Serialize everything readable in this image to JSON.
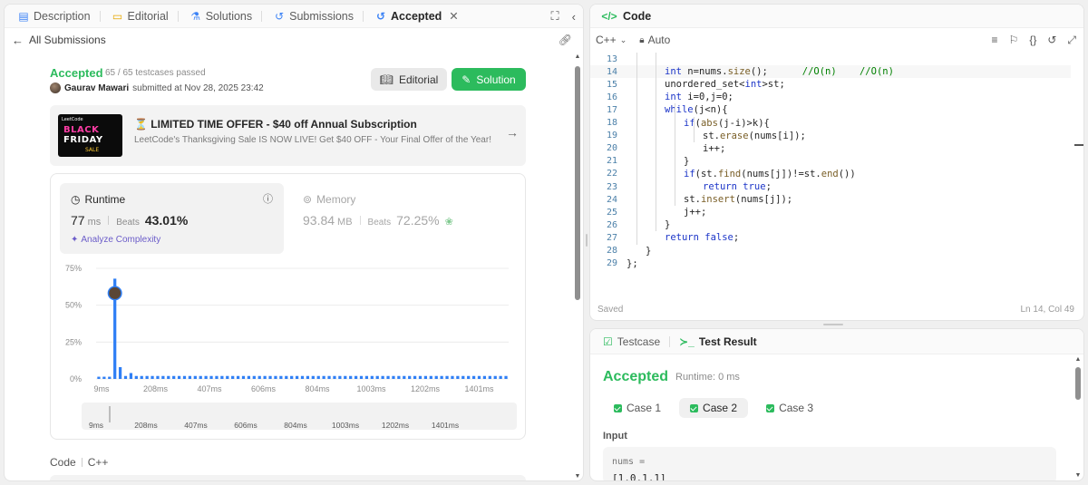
{
  "left_tabs": [
    {
      "label": "Description",
      "icon": "description-icon"
    },
    {
      "label": "Editorial",
      "icon": "book-icon"
    },
    {
      "label": "Solutions",
      "icon": "flask-icon"
    },
    {
      "label": "Submissions",
      "icon": "history-icon"
    },
    {
      "label": "Accepted",
      "icon": "history-icon"
    }
  ],
  "back_link": "All Submissions",
  "submission": {
    "status": "Accepted",
    "testcases": "65 / 65 testcases passed",
    "author": "Gaurav Mawari",
    "submitted_text": "submitted at Nov 28, 2025 23:42",
    "editorial_btn": "Editorial",
    "solution_btn": "Solution"
  },
  "promo": {
    "img_top": "LeetCode",
    "img_line1": "BLACK",
    "img_line2": "FRIDAY",
    "img_line3": "SALE",
    "title": "⏳ LIMITED TIME OFFER - $40 off Annual Subscription",
    "subtitle": "LeetCode's Thanksgiving Sale IS NOW LIVE! Get $40 OFF - Your Final Offer of the Year!"
  },
  "runtime": {
    "label": "Runtime",
    "value": "77",
    "unit": "ms",
    "beats_label": "Beats",
    "beats": "43.01%",
    "analyze": "Analyze Complexity"
  },
  "memory": {
    "label": "Memory",
    "value": "93.84",
    "unit": "MB",
    "beats_label": "Beats",
    "beats": "72.25%"
  },
  "chart_data": {
    "type": "bar",
    "y_ticks": [
      "75%",
      "50%",
      "25%",
      "0%"
    ],
    "ylim": [
      0,
      75
    ],
    "x_tick_labels": [
      "9ms",
      "208ms",
      "407ms",
      "606ms",
      "804ms",
      "1003ms",
      "1202ms",
      "1401ms"
    ],
    "values": [
      1.5,
      1.5,
      1.5,
      68,
      8,
      2,
      4,
      2,
      2,
      2,
      2,
      2,
      2,
      2,
      2,
      2,
      2,
      2,
      2,
      2,
      2,
      2,
      2,
      2,
      2,
      2,
      2,
      2,
      2,
      2,
      2,
      2,
      2,
      2,
      2,
      2,
      2,
      2,
      2,
      2,
      2,
      2,
      2,
      2,
      2,
      2,
      2,
      2,
      2,
      2,
      2,
      2,
      2,
      2,
      2,
      2,
      2,
      2,
      2,
      2,
      2,
      2,
      2,
      2,
      2,
      2,
      2,
      2,
      2,
      2,
      2,
      2,
      2,
      2,
      2,
      2,
      2
    ],
    "highlight_index": 3,
    "bar_color": "#2f7ff5",
    "minimap_labels": [
      "9ms",
      "208ms",
      "407ms",
      "606ms",
      "804ms",
      "1003ms",
      "1202ms",
      "1401ms"
    ]
  },
  "code_section": {
    "label": "Code",
    "lang": "C++"
  },
  "code_panel": {
    "title": "Code",
    "lang": "C++",
    "mode": "Auto",
    "saved": "Saved",
    "cursor": "Ln 14, Col 49"
  },
  "code_lines": [
    {
      "n": "13",
      "indent": 2,
      "parts": []
    },
    {
      "n": "14",
      "indent": 2,
      "parts": [
        {
          "t": "int ",
          "c": "kw"
        },
        {
          "t": "n=nums.",
          "c": ""
        },
        {
          "t": "size",
          "c": "fn"
        },
        {
          "t": "();      ",
          "c": ""
        },
        {
          "t": "//O(n)    //O(n)",
          "c": "cm"
        }
      ]
    },
    {
      "n": "15",
      "indent": 2,
      "parts": [
        {
          "t": "unordered_set<",
          "c": ""
        },
        {
          "t": "int",
          "c": "kw"
        },
        {
          "t": ">st;",
          "c": ""
        }
      ]
    },
    {
      "n": "16",
      "indent": 2,
      "parts": [
        {
          "t": "int ",
          "c": "kw"
        },
        {
          "t": "i=0,j=0;",
          "c": ""
        }
      ]
    },
    {
      "n": "17",
      "indent": 2,
      "parts": [
        {
          "t": "while",
          "c": "kw"
        },
        {
          "t": "(j<n){",
          "c": ""
        }
      ]
    },
    {
      "n": "18",
      "indent": 3,
      "parts": [
        {
          "t": "if",
          "c": "kw"
        },
        {
          "t": "(",
          "c": ""
        },
        {
          "t": "abs",
          "c": "fn"
        },
        {
          "t": "(j-i)>k){",
          "c": ""
        }
      ]
    },
    {
      "n": "19",
      "indent": 4,
      "parts": [
        {
          "t": "st.",
          "c": ""
        },
        {
          "t": "erase",
          "c": "fn"
        },
        {
          "t": "(nums[i]);",
          "c": ""
        }
      ]
    },
    {
      "n": "20",
      "indent": 4,
      "parts": [
        {
          "t": "i++;",
          "c": ""
        }
      ]
    },
    {
      "n": "21",
      "indent": 3,
      "parts": [
        {
          "t": "}",
          "c": ""
        }
      ]
    },
    {
      "n": "22",
      "indent": 3,
      "parts": [
        {
          "t": "if",
          "c": "kw"
        },
        {
          "t": "(st.",
          "c": ""
        },
        {
          "t": "find",
          "c": "fn"
        },
        {
          "t": "(nums[j])!=st.",
          "c": ""
        },
        {
          "t": "end",
          "c": "fn"
        },
        {
          "t": "())",
          "c": ""
        }
      ]
    },
    {
      "n": "23",
      "indent": 4,
      "parts": [
        {
          "t": "return ",
          "c": "kw"
        },
        {
          "t": "true",
          "c": "kw"
        },
        {
          "t": ";",
          "c": ""
        }
      ]
    },
    {
      "n": "24",
      "indent": 3,
      "parts": [
        {
          "t": "st.",
          "c": ""
        },
        {
          "t": "insert",
          "c": "fn"
        },
        {
          "t": "(nums[j]);",
          "c": ""
        }
      ]
    },
    {
      "n": "25",
      "indent": 3,
      "parts": [
        {
          "t": "j++;",
          "c": ""
        }
      ]
    },
    {
      "n": "26",
      "indent": 2,
      "parts": [
        {
          "t": "}",
          "c": ""
        }
      ]
    },
    {
      "n": "27",
      "indent": 2,
      "parts": [
        {
          "t": "return ",
          "c": "kw"
        },
        {
          "t": "false",
          "c": "kw"
        },
        {
          "t": ";",
          "c": ""
        }
      ]
    },
    {
      "n": "28",
      "indent": 1,
      "parts": [
        {
          "t": "}",
          "c": ""
        }
      ]
    },
    {
      "n": "29",
      "indent": 0,
      "parts": [
        {
          "t": "};",
          "c": ""
        }
      ]
    }
  ],
  "result": {
    "tab_testcase": "Testcase",
    "tab_result": "Test Result",
    "status": "Accepted",
    "runtime": "Runtime: 0 ms",
    "cases": [
      "Case 1",
      "Case 2",
      "Case 3"
    ],
    "active_case": 1,
    "input_label": "Input",
    "input_key": "nums =",
    "input_value": "[1,0,1,1]"
  }
}
